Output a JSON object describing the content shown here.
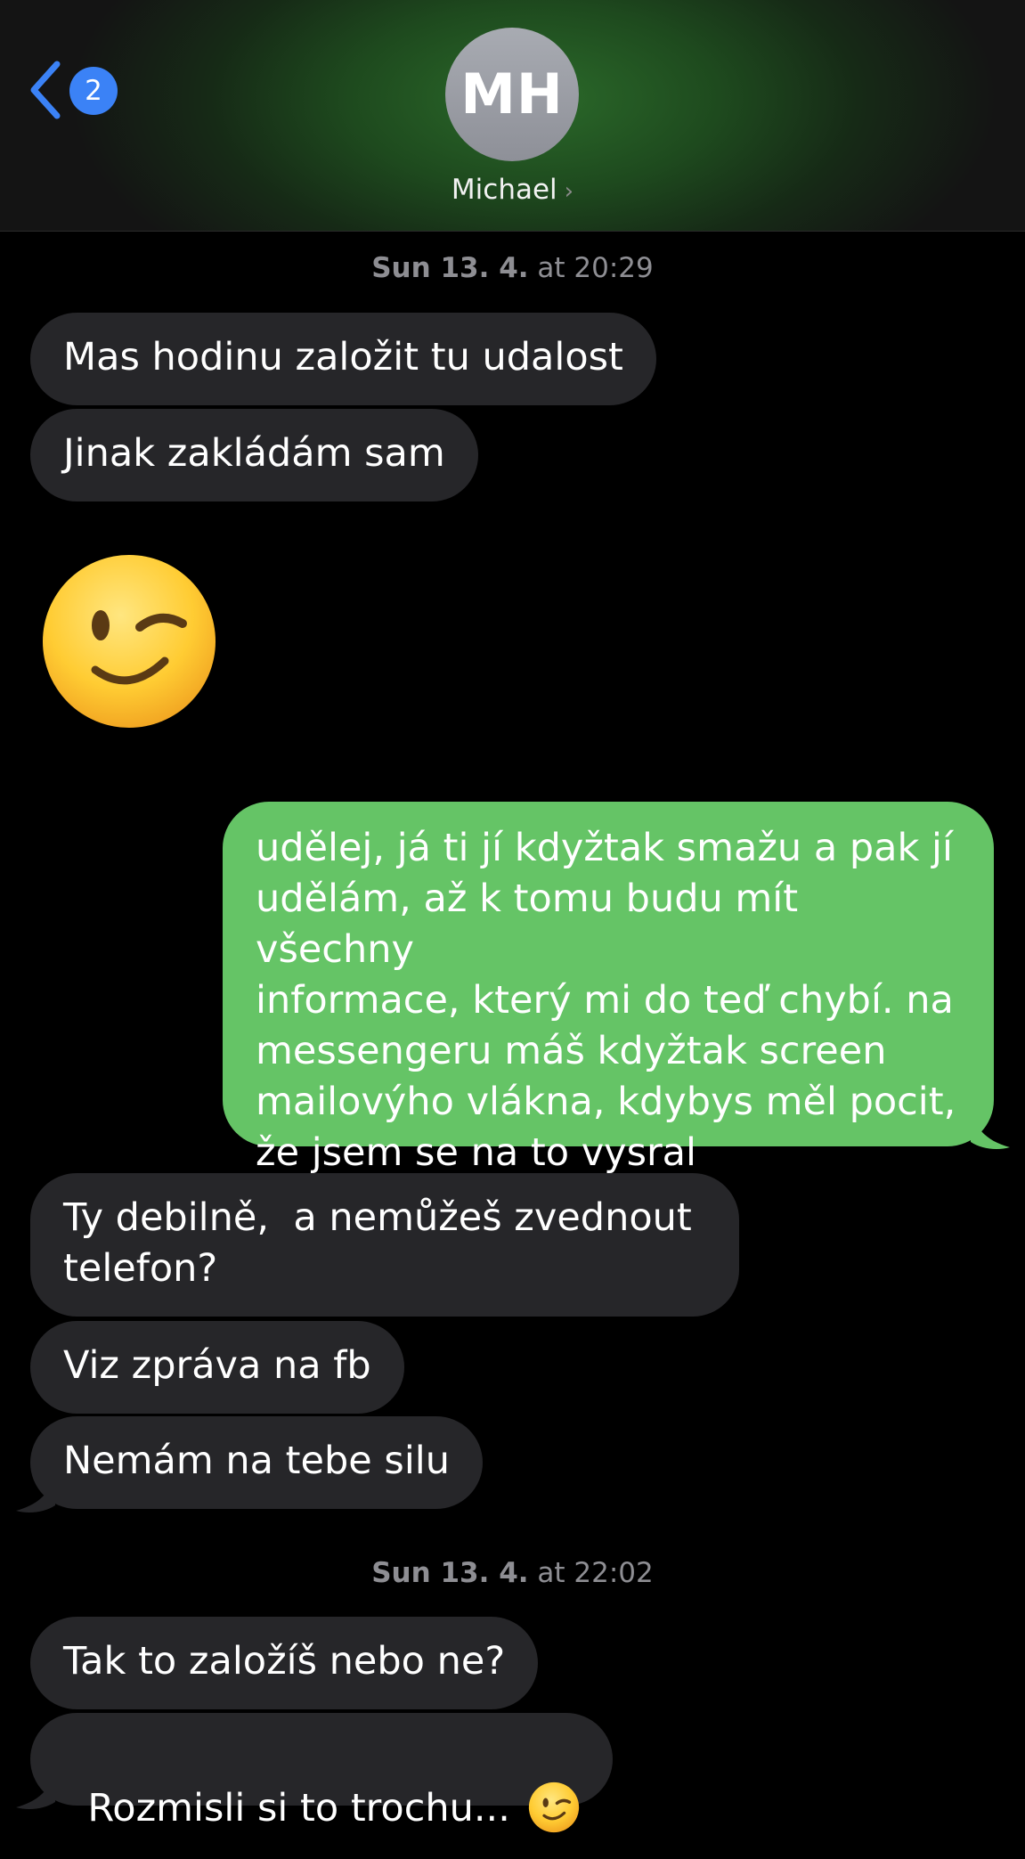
{
  "header": {
    "back_badge": "2",
    "avatar_initials": "MH",
    "contact_name": "Michael",
    "name_chevron": "›"
  },
  "colors": {
    "incoming_bubble": "#262629",
    "outgoing_bubble": "#65c466",
    "badge": "#3b82f6",
    "back_chevron": "#3b82f6"
  },
  "icons": {
    "back": "chevron-left-icon",
    "big_emoji": "winking-face-emoji",
    "inline_emoji": "winking-face-emoji"
  },
  "timestamps": [
    {
      "day": "Sun 13. 4.",
      "time": " at 20:29"
    },
    {
      "day": "Sun 13. 4.",
      "time": " at 22:02"
    }
  ],
  "messages": [
    {
      "dir": "in",
      "text": "Mas hodinu založit tu udalost"
    },
    {
      "dir": "in",
      "text": "Jinak zakládám sam"
    },
    {
      "dir": "in",
      "emoji": "winking-face-emoji"
    },
    {
      "dir": "out",
      "text": "udělej, já ti jí kdyžtak smažu a pak jí\nudělám, až k tomu budu mít všechny\ninformace, který mi do teď chybí. na\nmessengeru máš kdyžtak screen\nmailovýho vlákna, kdybys měl pocit,\nže jsem se na to vysral"
    },
    {
      "dir": "in",
      "text": "Ty debilně,  a nemůžeš zvednout\ntelefon?"
    },
    {
      "dir": "in",
      "text": "Viz zpráva na fb"
    },
    {
      "dir": "in",
      "text": "Nemám na tebe silu"
    },
    {
      "dir": "in",
      "text": "Tak to založíš nebo ne?"
    },
    {
      "dir": "in",
      "text": "Rozmisli si to trochu... "
    }
  ]
}
